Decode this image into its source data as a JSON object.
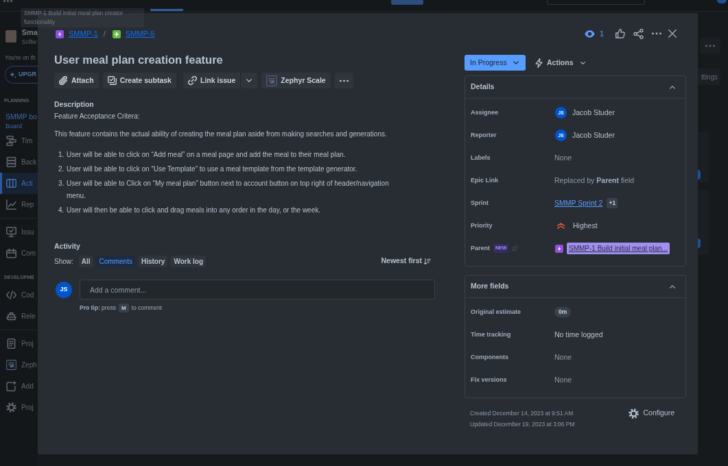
{
  "sidebar": {
    "project": {
      "name": "Sma",
      "type": "Softw"
    },
    "plan_note": "You're on th",
    "upgrade_button": "UPGR",
    "groups": [
      {
        "heading": "PLANNING",
        "board": {
          "name": "SMMP bo",
          "view": "Board"
        },
        "items": [
          {
            "label": "Tim",
            "selected": false
          },
          {
            "label": "Back",
            "selected": false
          },
          {
            "label": "Acti",
            "selected": true
          },
          {
            "label": "Rep",
            "selected": false
          }
        ]
      },
      {
        "items": [
          {
            "label": "Issu",
            "selected": false
          },
          {
            "label": "Com",
            "selected": false
          }
        ]
      },
      {
        "heading": "DEVELOPME",
        "items": [
          {
            "label": "Cod",
            "selected": false
          },
          {
            "label": "Rele",
            "selected": false
          }
        ]
      },
      {
        "items": [
          {
            "label": "Proj",
            "selected": false
          },
          {
            "label": "Zeph",
            "selected": false
          },
          {
            "label": "Add",
            "selected": false
          },
          {
            "label": "Proj",
            "selected": false
          }
        ]
      }
    ]
  },
  "board_header": {
    "settings_button": "ttings"
  },
  "tooltip": "SMMP-1 Build initial meal plan creator functionality",
  "issue": {
    "breadcrumbs": [
      {
        "kind": "epic",
        "key": "SMMP-1"
      },
      {
        "kind": "plus",
        "key": "SMMP-5"
      }
    ],
    "breadcrumb_separator": "/",
    "watchers": "1",
    "title": "User meal plan creation feature",
    "toolbar": [
      {
        "kind": "attach",
        "label": "Attach"
      },
      {
        "kind": "subtask",
        "label": "Create subtask"
      },
      {
        "kind": "link",
        "label": "Link issue"
      },
      {
        "kind": "zephyr",
        "label": "Zephyr Scale"
      },
      {
        "kind": "more"
      }
    ],
    "description": {
      "heading": "Description",
      "paragraphs": [
        "Feature Acceptance Critera:",
        "This feature contains the actual ability of creating the meal plan aside from making searches and generations."
      ],
      "list": [
        {
          "number": "1.",
          "text": "User will be able to click on “Add meal” on a meal page and add the meal to their meal plan."
        },
        {
          "number": "2.",
          "text": "User will be able to click on “Use Template” to use a meal template from the template generator."
        },
        {
          "number": "3.",
          "text": "User will be able to Click on “My meal plan” button next to account button on top right of header/navigation menu."
        },
        {
          "number": "4.",
          "text": "User will then be able to click and drag meals into any order in the day, or the week."
        }
      ]
    },
    "activity": {
      "heading": "Activity",
      "show_label": "Show:",
      "filters": [
        {
          "label": "All",
          "selected": false
        },
        {
          "label": "Comments",
          "selected": true
        },
        {
          "label": "History",
          "selected": false
        },
        {
          "label": "Work log",
          "selected": false
        }
      ],
      "sort": "Newest first",
      "comment": {
        "avatar": "JS",
        "placeholder": "Add a comment..."
      },
      "tip_start": "**Pro tip:** press",
      "tip_key": "M",
      "tip_end": "to comment"
    },
    "status": "In Progress",
    "actions": "Actions",
    "details": {
      "heading": "Details",
      "expanded": true,
      "fields": [
        {
          "kind": "user",
          "label": "Assignee",
          "avatar": "JS",
          "value": "Jacob Studer"
        },
        {
          "kind": "user",
          "label": "Reporter",
          "avatar": "JS",
          "value": "Jacob Studer"
        },
        {
          "kind": "empty",
          "label": "Labels",
          "value": "None"
        },
        {
          "kind": "muted",
          "label": "Epic Link",
          "value": "Replaced by **Parent** field"
        },
        {
          "kind": "sprint",
          "label": "Sprint",
          "value": "SMMP Sprint 2",
          "extra": "+1"
        },
        {
          "kind": "priority",
          "label": "Priority",
          "value": "Highest"
        },
        {
          "kind": "parent",
          "label": "Parent",
          "badge": "NEW",
          "value": "SMMP-1 Build initial meal plan..."
        }
      ]
    },
    "more_fields": {
      "heading": "More fields",
      "expanded": true,
      "fields": [
        {
          "kind": "pill",
          "label": "Original estimate",
          "value": "0m"
        },
        {
          "kind": "text",
          "label": "Time tracking",
          "value": "No time logged"
        },
        {
          "kind": "empty",
          "label": "Components",
          "value": "None"
        },
        {
          "kind": "empty",
          "label": "Fix versions",
          "value": "None"
        }
      ]
    },
    "created": "Created December 14, 2023 at 9:51 AM",
    "updated": "Updated December 19, 2023 at 3:06 PM",
    "configure": "Configure"
  }
}
